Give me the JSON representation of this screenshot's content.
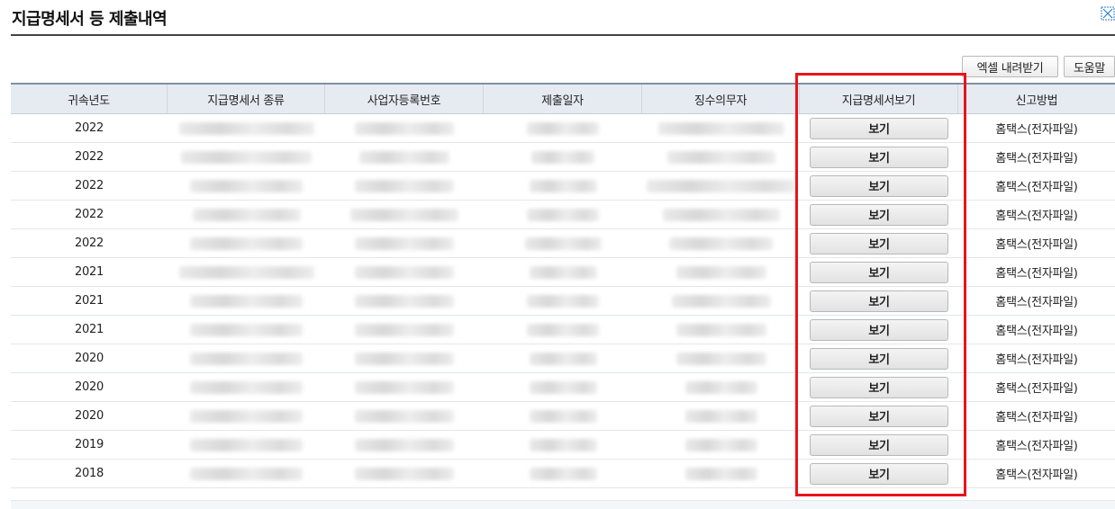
{
  "page": {
    "title": "지급명세서 등 제출내역",
    "corner_icon": "expand-icon"
  },
  "toolbar": {
    "excel_label": "엑셀 내려받기",
    "help_label": "도움말"
  },
  "table": {
    "headers": [
      "귀속년도",
      "지급명세서 종류",
      "사업자등록번호",
      "제출일자",
      "징수의무자",
      "지급명세서보기",
      "신고방법"
    ],
    "rows": [
      {
        "year": "2022",
        "view": "보기",
        "method": "홈택스(전자파일)"
      },
      {
        "year": "2022",
        "view": "보기",
        "method": "홈택스(전자파일)"
      },
      {
        "year": "2022",
        "view": "보기",
        "method": "홈택스(전자파일)"
      },
      {
        "year": "2022",
        "view": "보기",
        "method": "홈택스(전자파일)"
      },
      {
        "year": "2022",
        "view": "보기",
        "method": "홈택스(전자파일)"
      },
      {
        "year": "2021",
        "view": "보기",
        "method": "홈택스(전자파일)"
      },
      {
        "year": "2021",
        "view": "보기",
        "method": "홈택스(전자파일)"
      },
      {
        "year": "2021",
        "view": "보기",
        "method": "홈택스(전자파일)"
      },
      {
        "year": "2020",
        "view": "보기",
        "method": "홈택스(전자파일)"
      },
      {
        "year": "2020",
        "view": "보기",
        "method": "홈택스(전자파일)"
      },
      {
        "year": "2020",
        "view": "보기",
        "method": "홈택스(전자파일)"
      },
      {
        "year": "2019",
        "view": "보기",
        "method": "홈택스(전자파일)"
      },
      {
        "year": "2018",
        "view": "보기",
        "method": "홈택스(전자파일)"
      }
    ]
  },
  "colors": {
    "header_bg": "#e6ebf2",
    "highlight": "#e8141b"
  }
}
